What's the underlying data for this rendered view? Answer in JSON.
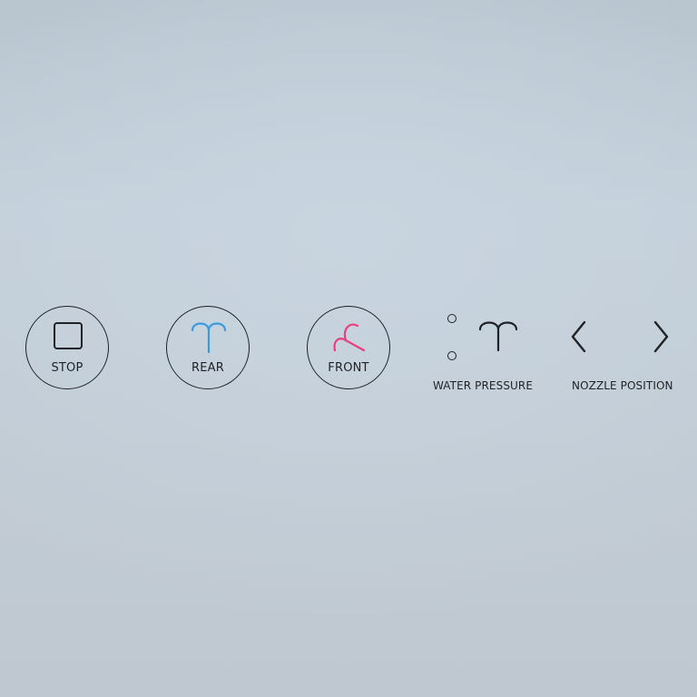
{
  "controls": {
    "stop": {
      "label": "STOP",
      "icon": "stop-square-icon"
    },
    "rear": {
      "label": "REAR",
      "icon": "rear-spray-icon",
      "color": "#3a9be0"
    },
    "front": {
      "label": "FRONT",
      "icon": "front-spray-icon",
      "color": "#e8407a"
    }
  },
  "water_pressure": {
    "label": "WATER PRESSURE",
    "icon": "spray-icon",
    "indicators": [
      "pressure-level-dot",
      "pressure-level-dot"
    ]
  },
  "nozzle_position": {
    "label": "NOZZLE POSITION",
    "left_icon": "chevron-left-icon",
    "right_icon": "chevron-right-icon"
  },
  "colors": {
    "line": "#1f2226",
    "rear_accent": "#3a9be0",
    "front_accent": "#e8407a"
  }
}
